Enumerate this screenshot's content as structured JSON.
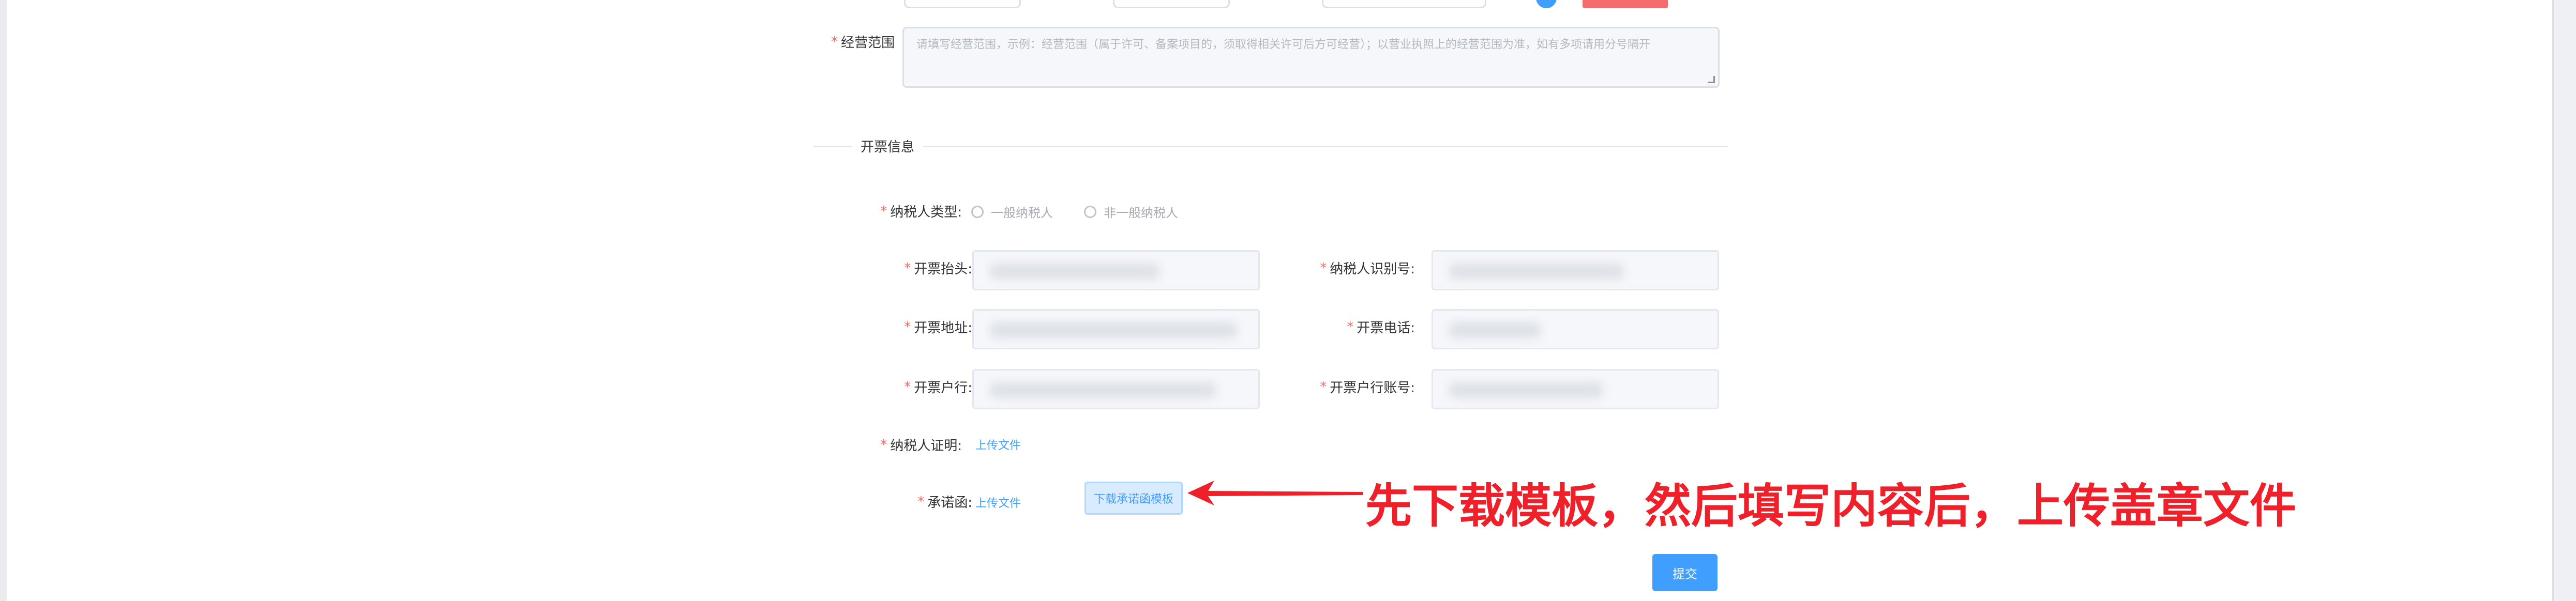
{
  "colors": {
    "primary": "#409eff",
    "danger": "#f56c6c",
    "annotation": "#f0202a",
    "input_bg": "#f5f7fa",
    "border": "#dcdfe6"
  },
  "required_mark": "*",
  "form": {
    "description": {
      "label": "经营范围",
      "placeholder": "请填写经营范围，示例：经营范围（属于许可、备案项目的，须取得相关许可后方可经营）；以营业执照上的经营范围为准，如有多项请用分号隔开"
    },
    "invoice_section": {
      "title": "开票信息",
      "taxpayer_type": {
        "label": "纳税人类型:",
        "options": [
          "一般纳税人",
          "非一般纳税人"
        ],
        "selected": ""
      },
      "invoice_title": {
        "label": "开票抬头:",
        "value": ""
      },
      "taxpayer_id": {
        "label": "纳税人识别号:",
        "value": ""
      },
      "address": {
        "label": "开票地址:",
        "value": ""
      },
      "phone": {
        "label": "开票电话:",
        "value": ""
      },
      "bank": {
        "label": "开票户行:",
        "value": ""
      },
      "bank_account": {
        "label": "开票户行账号:",
        "value": ""
      },
      "taxpayer_proof": {
        "label": "纳税人证明:",
        "upload_link": "上传文件"
      },
      "commitment_letter": {
        "label": "承诺函:",
        "upload_link": "上传文件",
        "download_button": "下载承诺函模板"
      }
    },
    "submit_button": "提交"
  },
  "annotation": {
    "text": "先下载模板，然后填写内容后，上传盖章文件"
  },
  "icons": {
    "arrow": "red-left-arrow-icon",
    "resize": "resize-grip-icon"
  }
}
